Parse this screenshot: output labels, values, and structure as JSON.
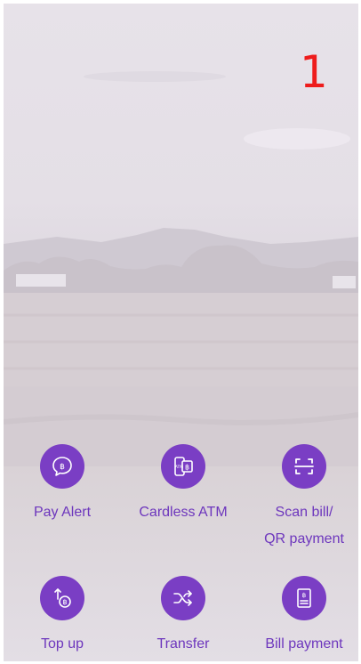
{
  "overlay": {
    "step_number": "1"
  },
  "menu": {
    "items": [
      {
        "label": "Pay Alert",
        "icon": "baht-chat-bubble-icon"
      },
      {
        "label": "Cardless ATM",
        "icon": "atm-phone-icon"
      },
      {
        "label": "Scan bill/",
        "label_line2": "QR payment",
        "icon": "scan-frame-icon"
      },
      {
        "label": "Top up",
        "icon": "top-up-coin-icon"
      },
      {
        "label": "Transfer",
        "icon": "shuffle-arrows-icon"
      },
      {
        "label": "Bill payment",
        "icon": "bill-document-icon"
      }
    ]
  },
  "colors": {
    "accent": "#7a3ec4",
    "label_text": "#6d36bd",
    "step_number": "#ee1c1c"
  }
}
